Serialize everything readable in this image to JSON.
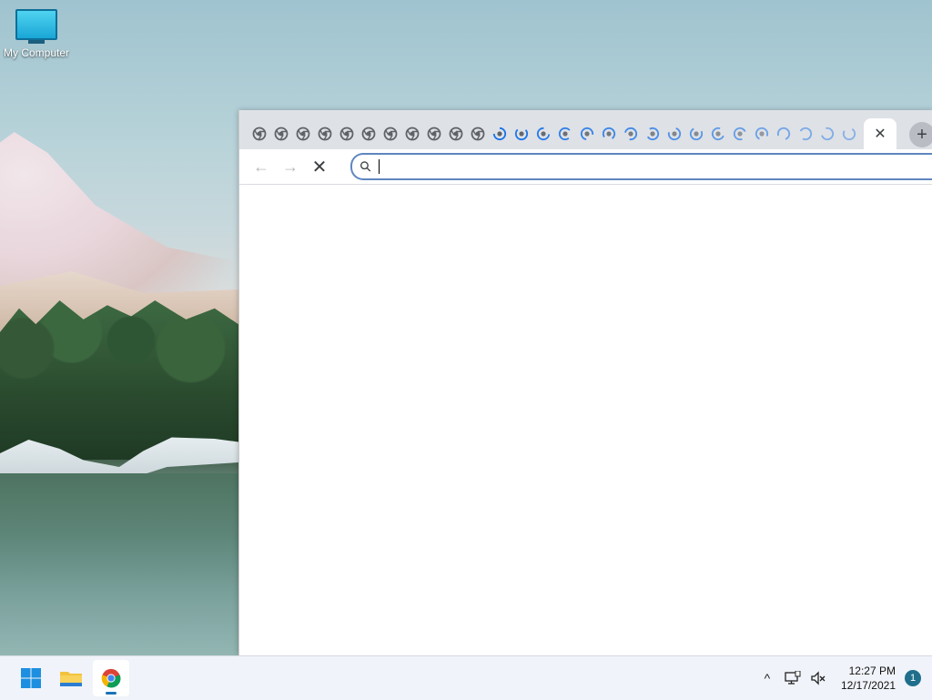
{
  "desktop": {
    "icon_label": "My Computer"
  },
  "browser": {
    "tabs": {
      "loaded_count": 11,
      "loading_count": 17,
      "active_close_symbol": "✕",
      "new_tab_symbol": "+"
    },
    "toolbar": {
      "back_symbol": "←",
      "forward_symbol": "→",
      "stop_symbol": "✕"
    },
    "omnibox": {
      "value": "",
      "placeholder": ""
    }
  },
  "taskbar": {
    "tray_chevron": "^",
    "clock_time": "12:27 PM",
    "clock_date": "12/17/2021",
    "notification_count": "1"
  },
  "colors": {
    "accent": "#1a73e8",
    "tabstrip_bg": "#dee1e6"
  }
}
